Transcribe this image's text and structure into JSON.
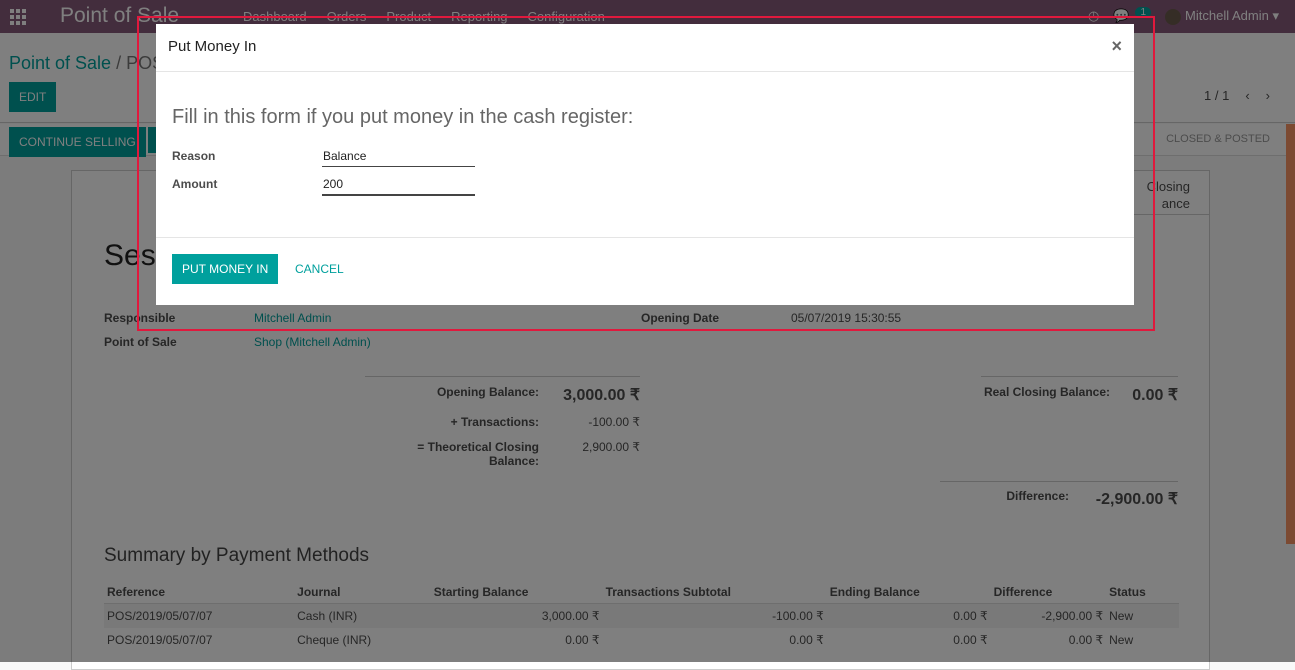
{
  "navbar": {
    "brand": "Point of Sale",
    "menu": [
      "Dashboard",
      "Orders",
      "Product",
      "Reporting",
      "Configuration"
    ],
    "chat_count": "1",
    "user": "Mitchell Admin",
    "color": "#875A7B"
  },
  "control_panel": {
    "breadcrumb_root": "Point of Sale",
    "breadcrumb_current": "POS",
    "edit": "EDIT",
    "pager": "1 / 1",
    "continue_selling": "CONTINUE SELLING",
    "stage_partial": "L",
    "stage_closed": "CLOSED & POSTED"
  },
  "sheet": {
    "title_partial": "Ses",
    "stat_button": "Closing\nance",
    "responsible_label": "Responsible",
    "responsible": "Mitchell Admin",
    "pos_label": "Point of Sale",
    "pos": "Shop (Mitchell Admin)",
    "opening_date_label": "Opening Date",
    "opening_date": "05/07/2019 15:30:55",
    "opening_balance_label": "Opening Balance:",
    "opening_balance": "3,000.00 ₹",
    "transactions_label": "+ Transactions:",
    "transactions": "-100.00 ₹",
    "theoretical_label": "= Theoretical Closing Balance:",
    "theoretical": "2,900.00 ₹",
    "real_closing_label": "Real Closing Balance:",
    "real_closing": "0.00 ₹",
    "difference_label": "Difference:",
    "difference": "-2,900.00 ₹",
    "summary_title": "Summary by Payment Methods",
    "columns": [
      "Reference",
      "Journal",
      "Starting Balance",
      "Transactions Subtotal",
      "Ending Balance",
      "Difference",
      "Status"
    ],
    "rows": [
      [
        "POS/2019/05/07/07",
        "Cash (INR)",
        "3,000.00 ₹",
        "-100.00 ₹",
        "0.00 ₹",
        "-2,900.00 ₹",
        "New"
      ],
      [
        "POS/2019/05/07/07",
        "Cheque (INR)",
        "0.00 ₹",
        "0.00 ₹",
        "0.00 ₹",
        "0.00 ₹",
        "New"
      ]
    ]
  },
  "dialog": {
    "title": "Put Money In",
    "heading": "Fill in this form if you put money in the cash register:",
    "reason_label": "Reason",
    "reason": "Balance",
    "amount_label": "Amount",
    "amount": "200",
    "submit": "PUT MONEY IN",
    "cancel": "CANCEL",
    "accent": "#00a09d"
  },
  "highlight_color": "#e0193d"
}
